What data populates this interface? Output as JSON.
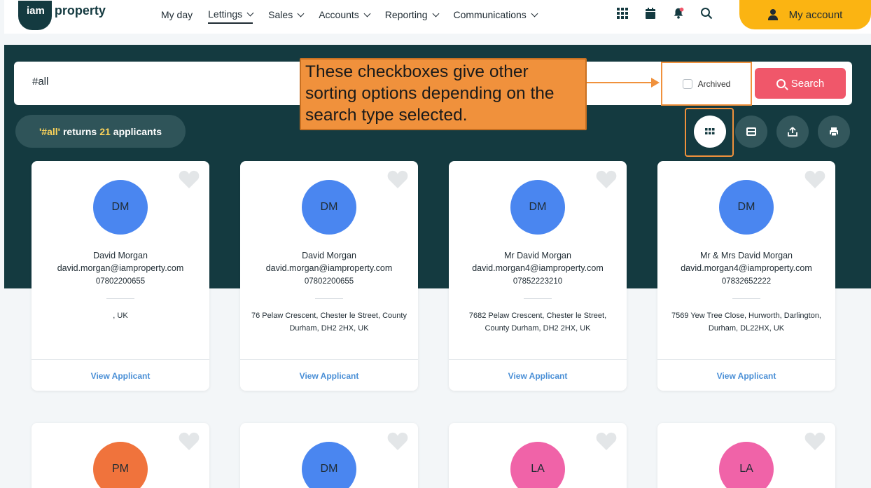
{
  "header": {
    "logo_pill": "iam",
    "logo_text": "property",
    "nav": [
      {
        "label": "My day",
        "dropdown": false,
        "active": false
      },
      {
        "label": "Lettings",
        "dropdown": true,
        "active": true
      },
      {
        "label": "Sales",
        "dropdown": true,
        "active": false
      },
      {
        "label": "Accounts",
        "dropdown": true,
        "active": false
      },
      {
        "label": "Reporting",
        "dropdown": true,
        "active": false
      },
      {
        "label": "Communications",
        "dropdown": true,
        "active": false
      }
    ],
    "icons": [
      "apps-grid-icon",
      "calendar-icon",
      "bell-icon",
      "search-icon"
    ],
    "account_label": "My account"
  },
  "search": {
    "value": "#all",
    "archived_label": "Archived",
    "button_label": "Search"
  },
  "results": {
    "query": "'#all'",
    "returns_word": "returns",
    "count": "21",
    "noun": "applicants"
  },
  "callout": {
    "text": "These checkboxes give other sorting options depending on the search type selected."
  },
  "view_buttons": [
    "grid-view-icon",
    "list-view-icon",
    "export-icon",
    "print-icon"
  ],
  "colors": {
    "band": "#143a40",
    "accent_yellow": "#fbb412",
    "search_red": "#f0576a",
    "callout_orange": "#f0913c",
    "link_blue": "#4a8fd6"
  },
  "cards": [
    {
      "initials": "DM",
      "color": "#4a86f0",
      "name": "David Morgan",
      "email": "david.morgan@iamproperty.com",
      "phone": "07802200655",
      "address": ", UK",
      "link": "View Applicant"
    },
    {
      "initials": "DM",
      "color": "#4a86f0",
      "name": "David Morgan",
      "email": "david.morgan@iamproperty.com",
      "phone": "07802200655",
      "address": "76 Pelaw Crescent, Chester le Street, County Durham, DH2 2HX, UK",
      "link": "View Applicant"
    },
    {
      "initials": "DM",
      "color": "#4a86f0",
      "name": "Mr David Morgan",
      "email": "david.morgan4@iamproperty.com",
      "phone": "07852223210",
      "address": "7682 Pelaw Crescent, Chester le Street, County Durham, DH2 2HX, UK",
      "link": "View Applicant"
    },
    {
      "initials": "DM",
      "color": "#4a86f0",
      "name": "Mr & Mrs David Morgan",
      "email": "david.morgan4@iamproperty.com",
      "phone": "07832652222",
      "address": "7569 Yew Tree Close, Hurworth, Darlington, Durham, DL22HX, UK",
      "link": "View Applicant"
    },
    {
      "initials": "PM",
      "color": "#f0733c"
    },
    {
      "initials": "DM",
      "color": "#4a86f0"
    },
    {
      "initials": "LA",
      "color": "#f063a8"
    },
    {
      "initials": "LA",
      "color": "#f063a8"
    }
  ]
}
